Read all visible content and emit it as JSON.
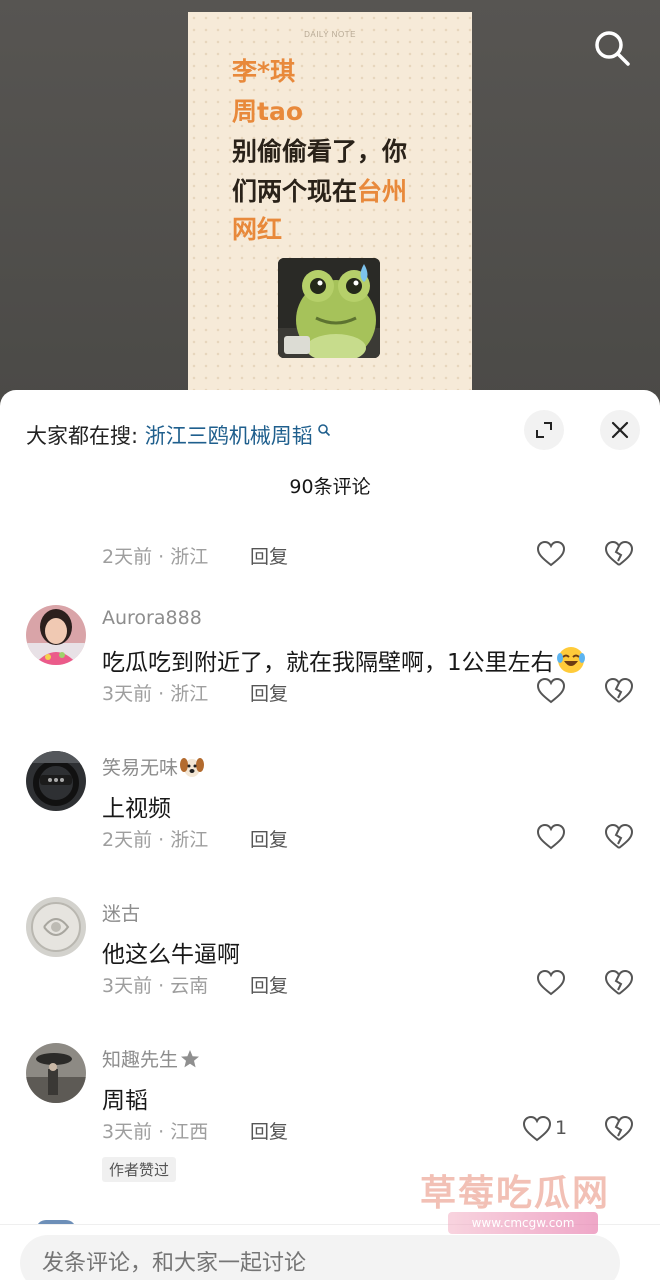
{
  "video": {
    "note_label": "DAILY NOTE",
    "lines": [
      "李*琪",
      "周tao",
      "别偷偷看了，你",
      "们两个现在",
      "台州",
      "网红"
    ]
  },
  "sheet": {
    "hot_search_prefix": "大家都在搜: ",
    "hot_search_keyword": "浙江三鸥机械周韬",
    "comment_count": "90条评论",
    "partial_comment_meta": "2天前 · 浙江",
    "comments": [
      {
        "user": "Aurora888",
        "text": "吃瓜吃到附近了，就在我隔壁啊，1公里左右",
        "meta": "3天前 · 浙江"
      },
      {
        "user": "笑易无味",
        "text": "上视频",
        "meta": "2天前 · 浙江"
      },
      {
        "user": "迷古",
        "text": "他这么牛逼啊",
        "meta": "3天前 · 云南"
      },
      {
        "user": "知趣先生",
        "text": "周韬",
        "meta": "3天前 · 江西",
        "likes": "1",
        "badge": "作者赞过"
      }
    ],
    "reply_label": "回复",
    "input_placeholder": "发条评论，和大家一起讨论"
  },
  "watermark": {
    "title": "草莓吃瓜网",
    "url": "www.cmcgw.com"
  },
  "icons": [
    "search-icon",
    "expand-icon",
    "close-icon",
    "heart-icon",
    "broken-heart-icon",
    "crying-laugh-emoji",
    "dog-emoji",
    "star-icon"
  ],
  "colors": {
    "accent_orange": "#e8893b",
    "keyword_blue": "#1f5f8d",
    "note_bg": "#f6ead8"
  }
}
